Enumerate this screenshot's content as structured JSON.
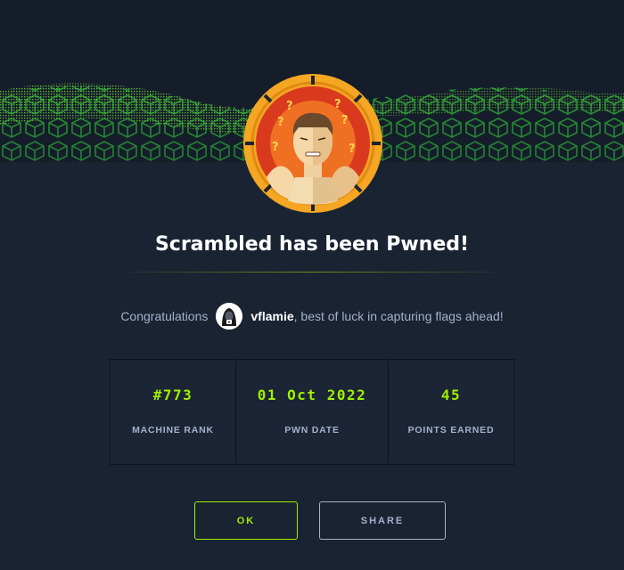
{
  "header": {
    "title": "Scrambled has been Pwned!"
  },
  "message": {
    "prefix": "Congratulations",
    "username": "vflamie",
    "suffix": ", best of luck in capturing flags ahead!"
  },
  "stats": [
    {
      "value": "#773",
      "label": "MACHINE RANK"
    },
    {
      "value": "01 Oct 2022",
      "label": "PWN DATE"
    },
    {
      "value": "45",
      "label": "POINTS EARNED"
    }
  ],
  "actions": {
    "ok_label": "OK",
    "share_label": "SHARE"
  },
  "colors": {
    "accent": "#9fef00",
    "background": "#1a2332",
    "muted_text": "#a4b1cd",
    "badge_ring": "#f5a623"
  },
  "icons": {
    "banner": "green-cube-wave-banner",
    "machine_avatar": "confused-man-with-question-marks",
    "user_avatar": "hooded-hacker-icon"
  }
}
